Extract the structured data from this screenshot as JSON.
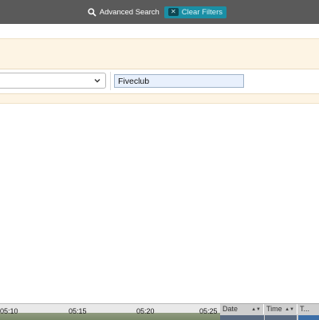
{
  "toolbar": {
    "advanced_search_label": "Advanced Search",
    "clear_filters_label": "Clear Filters"
  },
  "filter": {
    "text_value": "Fiveclub"
  },
  "timeline": {
    "ticks": [
      "05:10",
      "05:15",
      "05:20",
      "05:25"
    ]
  },
  "table": {
    "columns": [
      "Date",
      "Time",
      "T..."
    ]
  },
  "colors": {
    "toolbar_bg": "#5a5a5a",
    "clear_filters_bg": "#1a8fa5",
    "filter_panel_bg": "#fdf4e4",
    "input_bg": "#e8f0fc"
  }
}
